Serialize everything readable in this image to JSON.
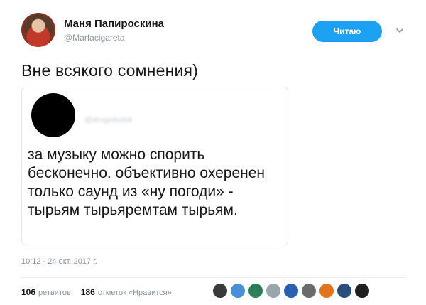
{
  "author": {
    "name": "Маня Папироскина",
    "handle": "@Marfacigareta",
    "avatar_color": "#8c2d22"
  },
  "follow_button": {
    "label": "Читаю",
    "color": "#1da1f2"
  },
  "more_icon": "chevron-down-icon",
  "tweet": {
    "text": "Вне всякого сомнения)"
  },
  "quoted_tweet": {
    "handle": "@drugoikolok",
    "text": "за музыку можно спорить бесконечно. объективно охеренен только саунд из «ну погоди» - тырьям тырьяремтам тырьям."
  },
  "timestamp": "10:12 - 24 окт. 2017 г.",
  "stats": {
    "retweets_count": "106",
    "retweets_label": "ретвитов",
    "likes_count": "186",
    "likes_label": "отметок «Нравится»"
  },
  "liker_avatars": [
    {
      "color": "#3a3a3a"
    },
    {
      "color": "#4a90d9"
    },
    {
      "color": "#2e7d5b"
    },
    {
      "color": "#9aa5ad"
    },
    {
      "color": "#2b5fb0"
    },
    {
      "color": "#6b6b6b"
    },
    {
      "color": "#e2741e"
    },
    {
      "color": "#2a4f7a"
    },
    {
      "color": "#1f1f1f"
    }
  ]
}
